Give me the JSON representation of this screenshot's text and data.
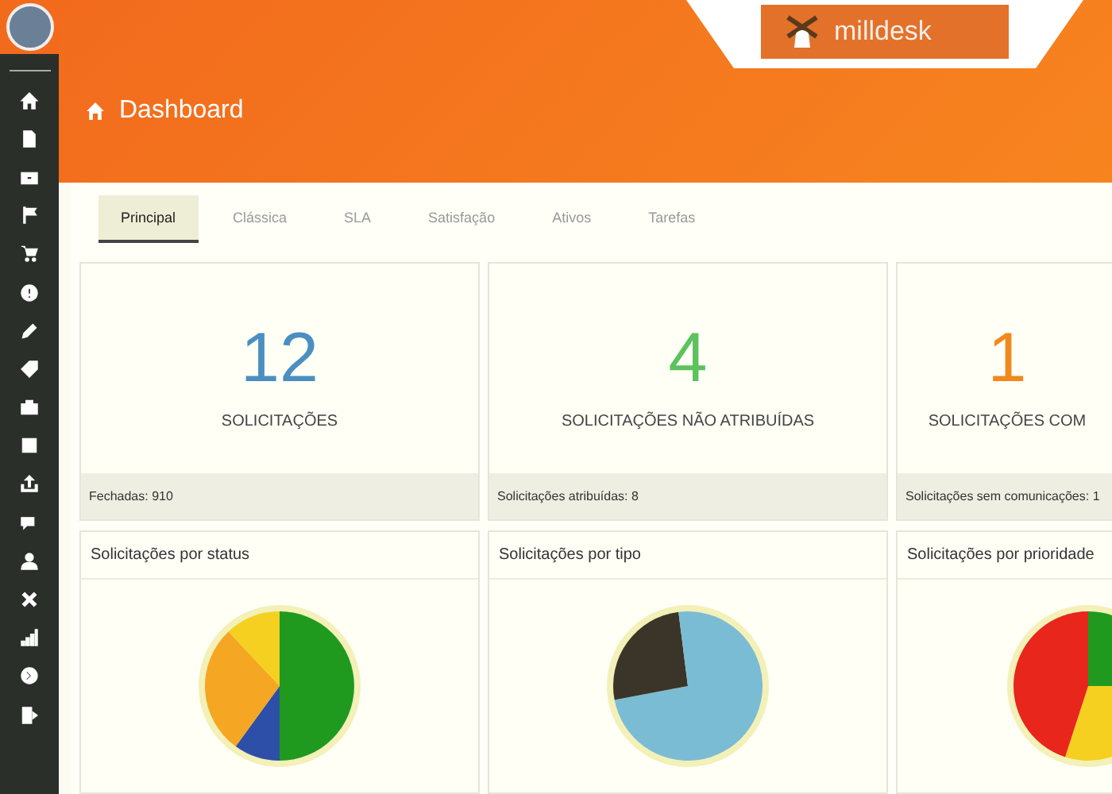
{
  "brand": {
    "name": "milldesk"
  },
  "header": {
    "title": "Dashboard"
  },
  "tabs": [
    {
      "label": "Principal",
      "selected": true
    },
    {
      "label": "Clássica",
      "selected": false
    },
    {
      "label": "SLA",
      "selected": false
    },
    {
      "label": "Satisfação",
      "selected": false
    },
    {
      "label": "Ativos",
      "selected": false
    },
    {
      "label": "Tarefas",
      "selected": false
    }
  ],
  "stats": [
    {
      "value": "12",
      "label": "SOLICITAÇÕES",
      "footer": "Fechadas: 910",
      "color": "#4a8fc0"
    },
    {
      "value": "4",
      "label": "SOLICITAÇÕES NÃO ATRIBUÍDAS",
      "footer": "Solicitações atribuídas: 8",
      "color": "#5cc25c"
    },
    {
      "value": "1",
      "label": "SOLICITAÇÕES COM",
      "footer": "Solicitações sem comunicações: 1",
      "color": "#f08a1c"
    }
  ],
  "charts": [
    {
      "title": "Solicitações por status"
    },
    {
      "title": "Solicitações por tipo"
    },
    {
      "title": "Solicitações por prioridade"
    }
  ]
}
